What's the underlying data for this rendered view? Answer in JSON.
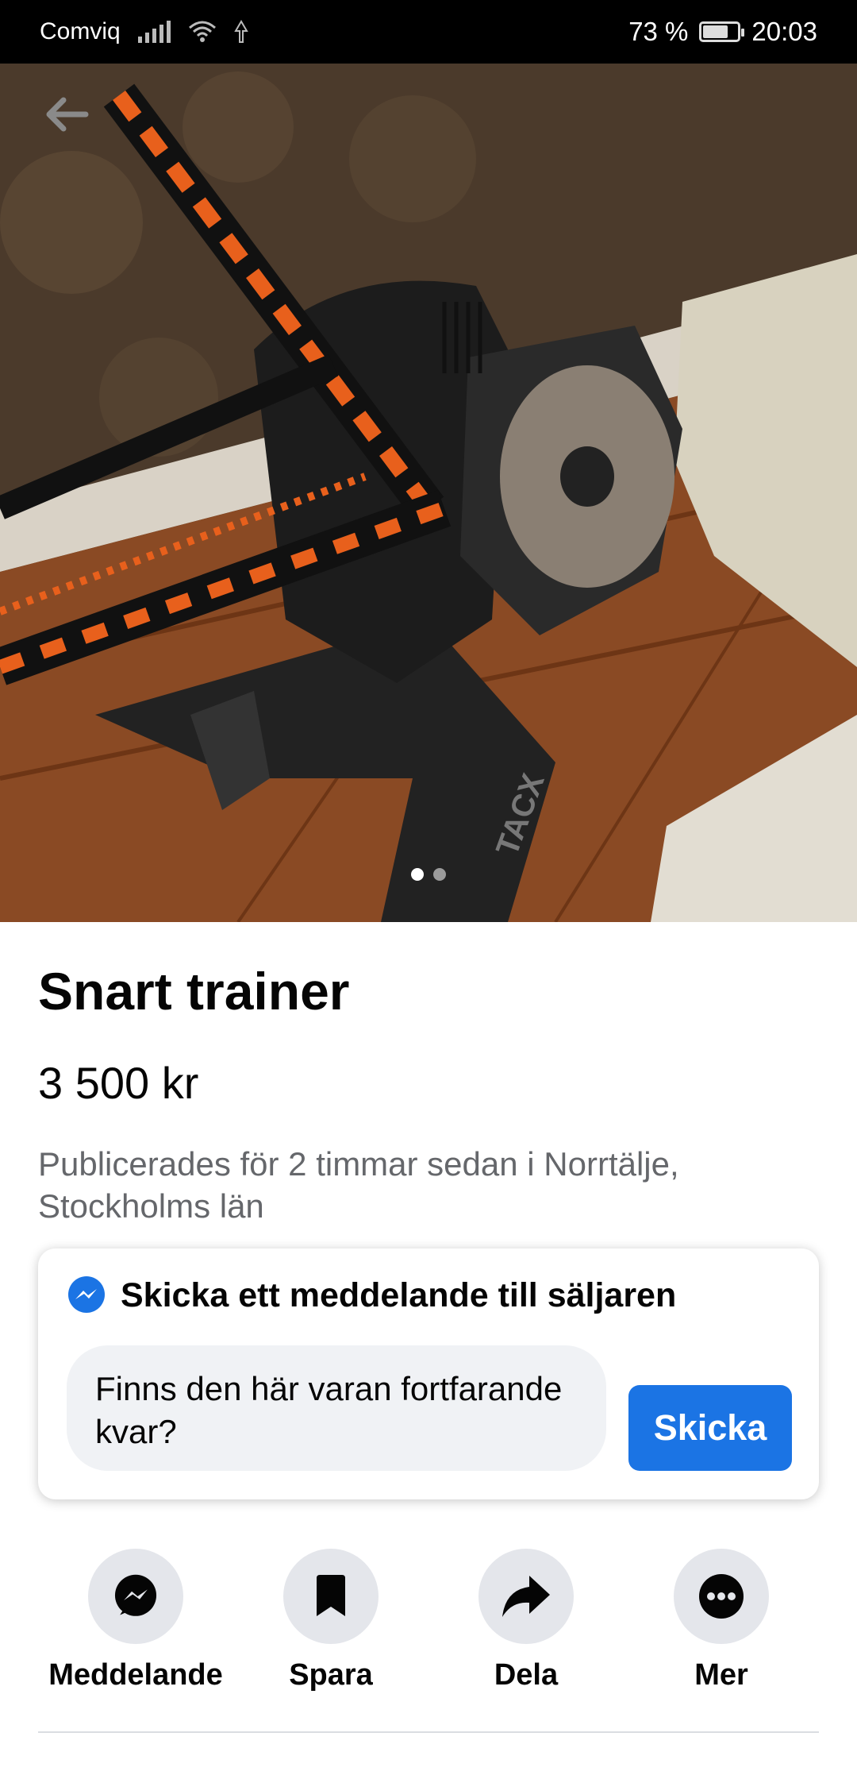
{
  "status_bar": {
    "carrier": "Comviq",
    "battery_percent": "73 %",
    "battery_level": 0.73,
    "time": "20:03"
  },
  "hero": {
    "photo_description": "Tacx smart bike trainer with orange and black bicycle frame on wooden floor",
    "brand_text": "TACX",
    "page_count": 2,
    "current_page": 1
  },
  "listing": {
    "title": "Snart trainer",
    "price": "3 500 kr",
    "published": "Publicerades för 2 timmar sedan i Norrtälje, Stockholms län"
  },
  "message_card": {
    "heading": "Skicka ett meddelande till säljaren",
    "input_text": "Finns den här varan fortfarande kvar?",
    "send_label": "Skicka"
  },
  "actions": [
    {
      "label": "Meddelande",
      "icon": "messenger-icon"
    },
    {
      "label": "Spara",
      "icon": "bookmark-icon"
    },
    {
      "label": "Dela",
      "icon": "share-icon"
    },
    {
      "label": "Mer",
      "icon": "more-icon"
    }
  ],
  "colors": {
    "accent": "#1b74e4",
    "secondary_text": "#65676b",
    "action_bg": "#e4e6eb"
  }
}
